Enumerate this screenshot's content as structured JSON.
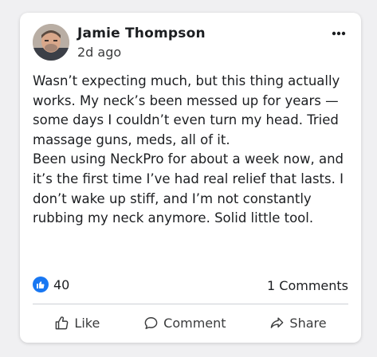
{
  "post": {
    "author_name": "Jamie Thompson",
    "timestamp": "2d ago",
    "more_icon": "more-horizontal-icon",
    "paragraphs": [
      "Wasn’t expecting much, but this thing actually works. My neck’s been messed up for years — some days I couldn’t even turn my head. Tried massage guns, meds, all of it.",
      "Been using NeckPro for about a week now, and it’s the first time I’ve had real relief that lasts. I don’t wake up stiff, and I’m not constantly rubbing my neck anymore. Solid little tool."
    ]
  },
  "stats": {
    "like_count": "40",
    "comments_label": "1 Comments"
  },
  "actions": {
    "like_label": "Like",
    "comment_label": "Comment",
    "share_label": "Share"
  },
  "colors": {
    "like_blue": "#1877f2",
    "card_bg": "#ffffff",
    "page_bg": "#f0f0f2"
  }
}
